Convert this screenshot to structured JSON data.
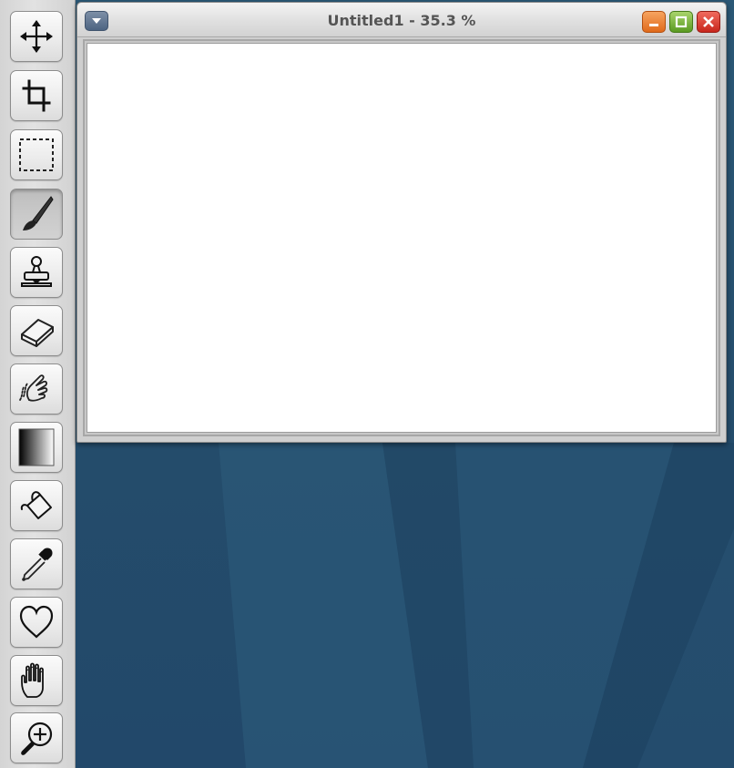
{
  "window": {
    "title": "Untitled1 - 35.3 %",
    "buttons": [
      "minimize",
      "maximize",
      "close"
    ]
  },
  "toolbar": {
    "tools": [
      {
        "name": "move-tool",
        "icon": "move-arrows-icon",
        "active": false
      },
      {
        "name": "crop-tool",
        "icon": "crop-icon",
        "active": false
      },
      {
        "name": "selection-tool",
        "icon": "dashed-rectangle-icon",
        "active": false
      },
      {
        "name": "brush-tool",
        "icon": "brush-icon",
        "active": true
      },
      {
        "name": "clone-stamp-tool",
        "icon": "stamp-icon",
        "active": false
      },
      {
        "name": "eraser-tool",
        "icon": "eraser-icon",
        "active": false
      },
      {
        "name": "smudge-tool",
        "icon": "smudge-finger-icon",
        "active": false
      },
      {
        "name": "gradient-tool",
        "icon": "gradient-icon",
        "active": false
      },
      {
        "name": "fill-bucket-tool",
        "icon": "paint-bucket-icon",
        "active": false
      },
      {
        "name": "eyedropper-tool",
        "icon": "eyedropper-icon",
        "active": false
      },
      {
        "name": "shape-tool",
        "icon": "heart-icon",
        "active": false
      },
      {
        "name": "hand-tool",
        "icon": "hand-icon",
        "active": false
      },
      {
        "name": "zoom-tool",
        "icon": "zoom-in-icon",
        "active": false
      }
    ]
  },
  "colors": {
    "desktop_background": "#26506f",
    "minimize_button": "#e06a1b",
    "maximize_button": "#5a9a22",
    "close_button": "#c8261c",
    "canvas": "#ffffff"
  }
}
